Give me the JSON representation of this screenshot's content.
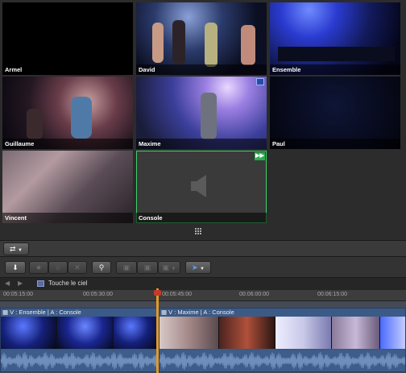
{
  "angles": [
    {
      "label": "Armel"
    },
    {
      "label": "David"
    },
    {
      "label": "Ensemble"
    },
    {
      "label": "Guillaume"
    },
    {
      "label": "Maxime"
    },
    {
      "label": "Paul"
    },
    {
      "label": "Vincent"
    },
    {
      "label": "Console"
    }
  ],
  "project": {
    "title": "Touche le ciel"
  },
  "ruler": {
    "ticks": [
      "00:05:15:00",
      "00:05:30:00",
      "00:05:45:00",
      "00:06:00:00",
      "00:06:15:00"
    ]
  },
  "clips": [
    {
      "name": "V : Ensemble | A : Console"
    },
    {
      "name": "V : Maxime | A : Console"
    }
  ],
  "colors": {
    "video_selection": "#8fb4ff",
    "audio_selection": "#3fd06a",
    "playhead": "#e09a2a"
  },
  "icons": {
    "switch_mode": "switch-icon",
    "import": "download-arrow-icon",
    "keyword": "key-icon",
    "select_tool": "pointer-arrow-icon"
  }
}
